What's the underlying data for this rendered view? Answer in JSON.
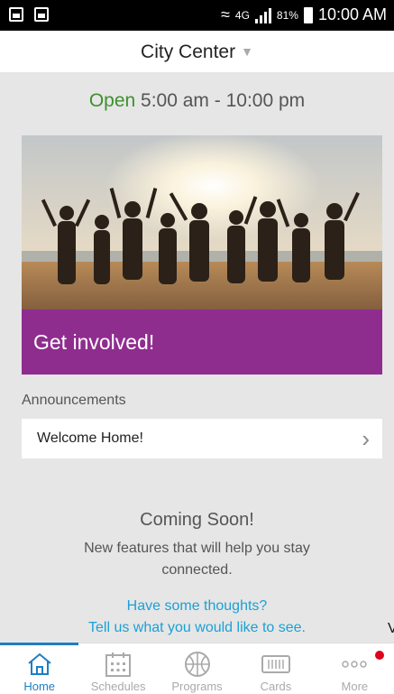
{
  "status_bar": {
    "network": "4G",
    "battery": "81%",
    "time": "10:00 AM"
  },
  "header": {
    "location": "City Center"
  },
  "hours": {
    "status": "Open",
    "range": "5:00 am - 10:00 pm"
  },
  "hero": {
    "banner_label": "Get involved!",
    "banner_color": "#8f2d8f"
  },
  "announcements": {
    "title": "Announcements",
    "items": [
      {
        "label": "Welcome Home!"
      }
    ]
  },
  "coming_soon": {
    "title": "Coming Soon!",
    "description": "New features that will help you stay connected.",
    "feedback_line1": "Have some thoughts?",
    "feedback_line2": "Tell us what you would like to see."
  },
  "stray_char": "V",
  "tabs": [
    {
      "label": "Home",
      "icon": "home-icon",
      "active": true
    },
    {
      "label": "Schedules",
      "icon": "calendar-icon"
    },
    {
      "label": "Programs",
      "icon": "basketball-icon"
    },
    {
      "label": "Cards",
      "icon": "card-icon"
    },
    {
      "label": "More",
      "icon": "more-dots-icon",
      "notification": true
    }
  ],
  "colors": {
    "accent": "#1e7fc2",
    "link": "#1aa1d6",
    "open": "#3f8f2f",
    "notification": "#e0001b"
  }
}
